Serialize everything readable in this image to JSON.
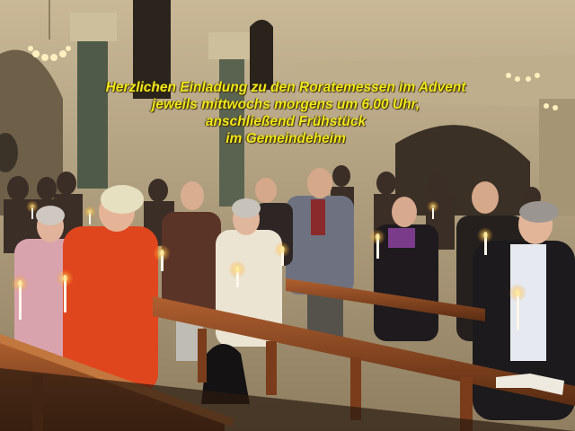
{
  "caption": {
    "line1": "Herzlichen Einladung zu den Roratemessen im Advent",
    "line2": "jeweils mittwochs morgens um 6.00 Uhr,",
    "line3": "anschließend Frühstück",
    "line4": "im Gemeindeheim"
  },
  "colors": {
    "caption": "#f2ea18",
    "wall": "#b9a98a",
    "pew_wood": "#8a4a22",
    "candle_flame": "#ffd36a"
  }
}
